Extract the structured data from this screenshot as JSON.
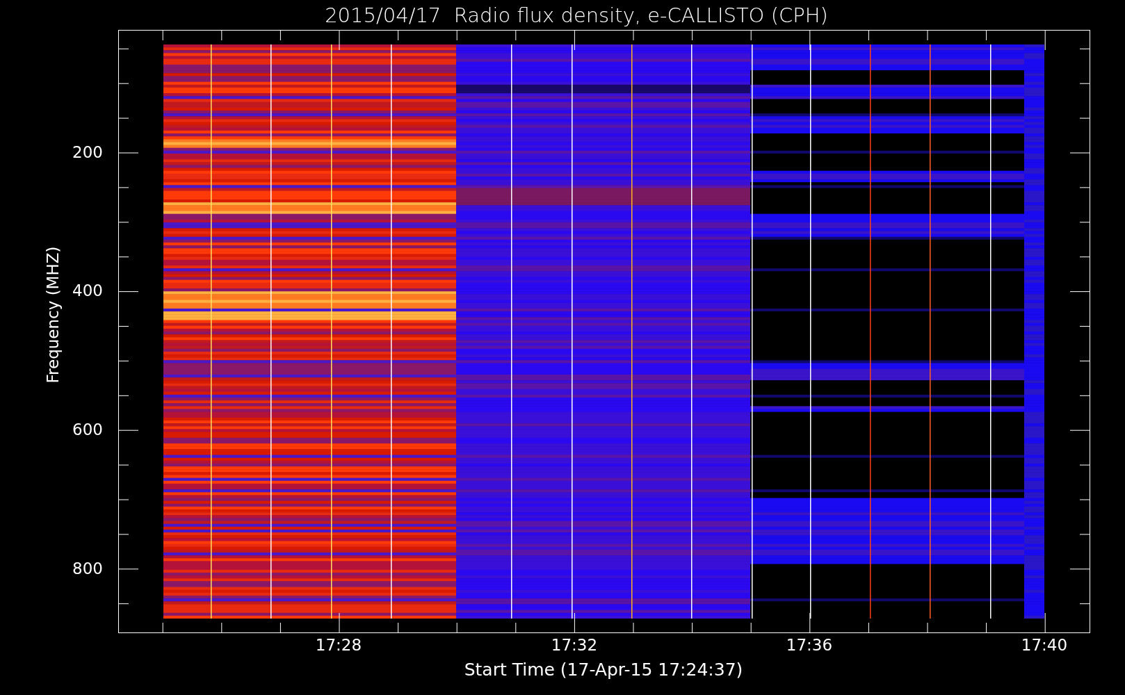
{
  "title": "2015/04/17  Radio flux density, e-CALLISTO (CPH)",
  "y_axis": {
    "label": "Frequency (MHZ)",
    "ticks": [
      "200",
      "400",
      "600",
      "800"
    ]
  },
  "x_axis": {
    "label": "Start Time (17-Apr-15 17:24:37)",
    "ticks": [
      "17:28",
      "17:32",
      "17:36",
      "17:40"
    ]
  }
}
